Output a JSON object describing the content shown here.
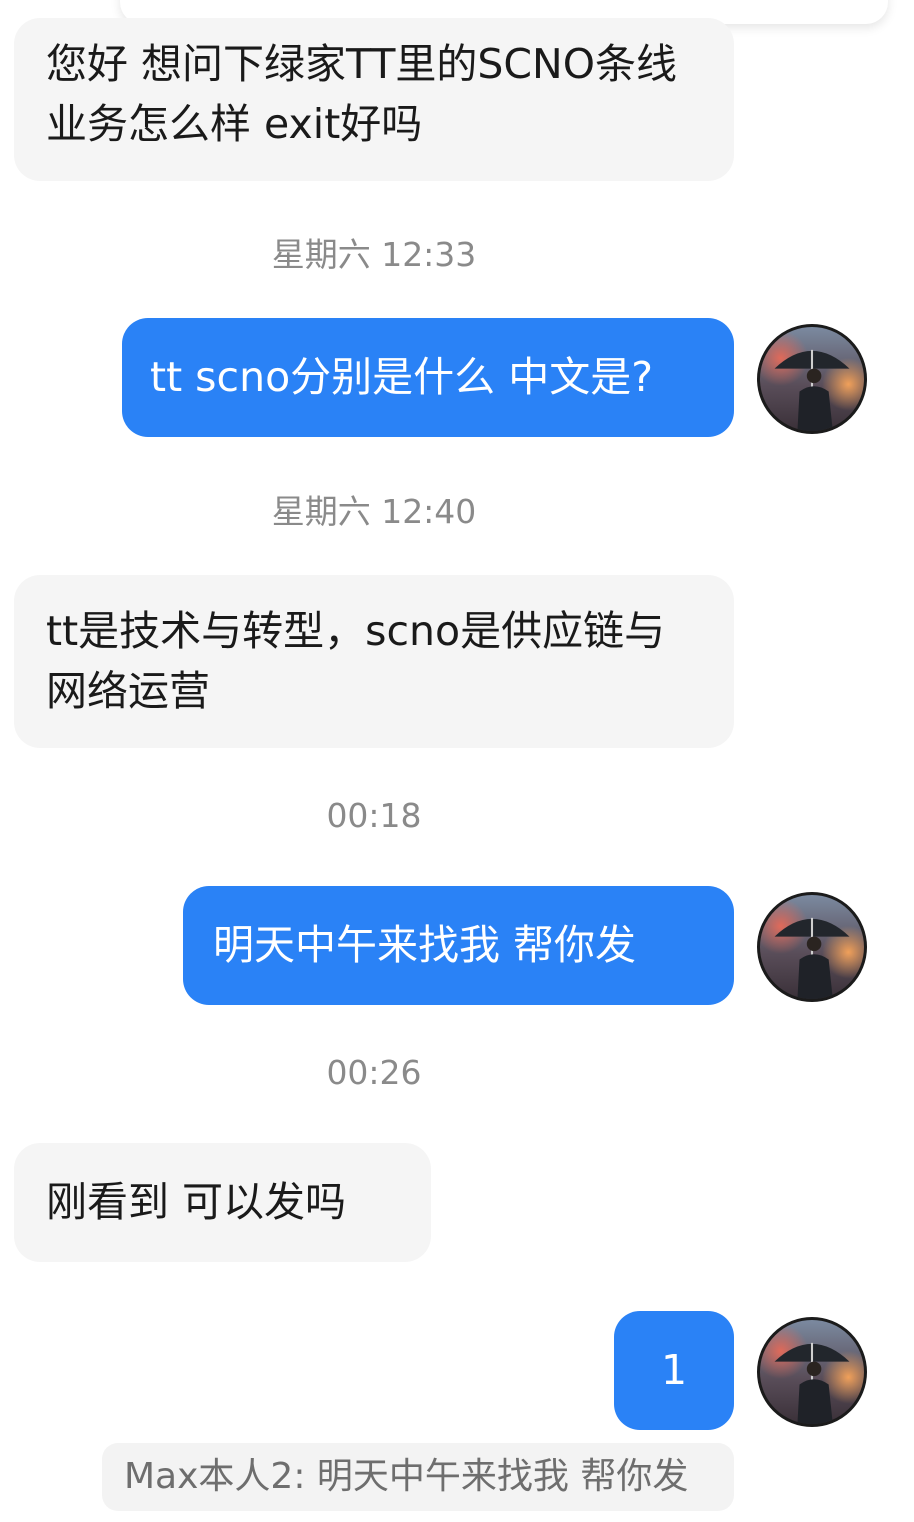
{
  "messages": [
    {
      "direction": "incoming",
      "text": "您好  想问下绿家TT里的SCNO条线  业务怎么样  exit好吗"
    },
    {
      "timestamp": "星期六 12:33"
    },
    {
      "direction": "outgoing",
      "text": "tt scno分别是什么 中文是?"
    },
    {
      "timestamp": "星期六 12:40"
    },
    {
      "direction": "incoming",
      "text": "tt是技术与转型，scno是供应链与网络运营"
    },
    {
      "timestamp": "00:18"
    },
    {
      "direction": "outgoing",
      "text": "明天中午来找我 帮你发"
    },
    {
      "timestamp": "00:26"
    },
    {
      "direction": "incoming",
      "text": "刚看到  可以发吗"
    },
    {
      "direction": "outgoing",
      "text": "1"
    }
  ],
  "quoted_reply": "Max本人2: 明天中午来找我 帮你发",
  "avatar_icon": "man-with-umbrella-avatar",
  "colors": {
    "outgoing_bubble": "#2a82f6",
    "incoming_bubble": "#f5f5f5",
    "timestamp_text": "#8a8a8a"
  }
}
